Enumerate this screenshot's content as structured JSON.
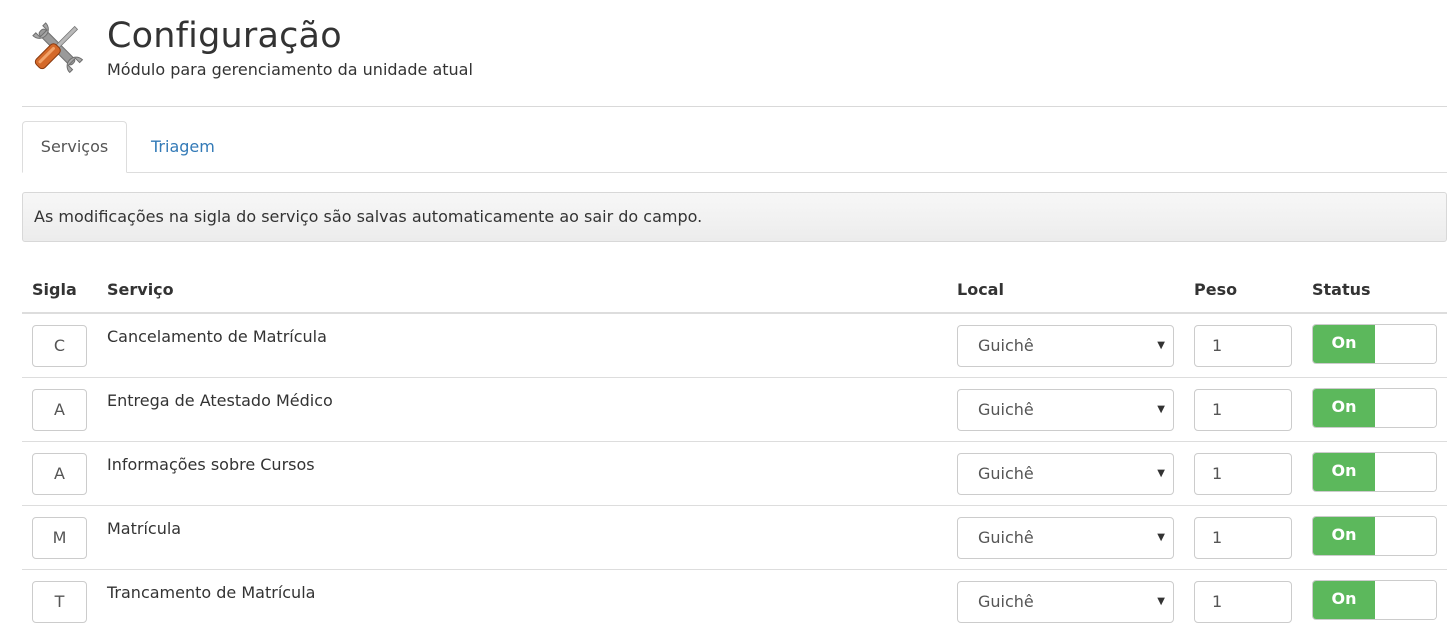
{
  "header": {
    "icon": "tools-icon",
    "title": "Configuração",
    "subtitle": "Módulo para gerenciamento da unidade atual"
  },
  "tabs": [
    {
      "label": "Serviços",
      "active": true
    },
    {
      "label": "Triagem",
      "active": false
    }
  ],
  "alert": {
    "text": "As modificações na sigla do serviço são salvas automaticamente ao sair do campo."
  },
  "table": {
    "headers": {
      "sigla": "Sigla",
      "servico": "Serviço",
      "local": "Local",
      "peso": "Peso",
      "status": "Status"
    },
    "rows": [
      {
        "sigla": "C",
        "servico": "Cancelamento de Matrícula",
        "local": "Guichê",
        "peso": "1",
        "status": "On"
      },
      {
        "sigla": "A",
        "servico": "Entrega de Atestado Médico",
        "local": "Guichê",
        "peso": "1",
        "status": "On"
      },
      {
        "sigla": "A",
        "servico": "Informações sobre Cursos",
        "local": "Guichê",
        "peso": "1",
        "status": "On"
      },
      {
        "sigla": "M",
        "servico": "Matrícula",
        "local": "Guichê",
        "peso": "1",
        "status": "On"
      },
      {
        "sigla": "T",
        "servico": "Trancamento de Matrícula",
        "local": "Guichê",
        "peso": "1",
        "status": "On"
      }
    ]
  },
  "colors": {
    "link": "#337ab7",
    "toggle_on": "#5cb85c",
    "border": "#dddddd"
  }
}
